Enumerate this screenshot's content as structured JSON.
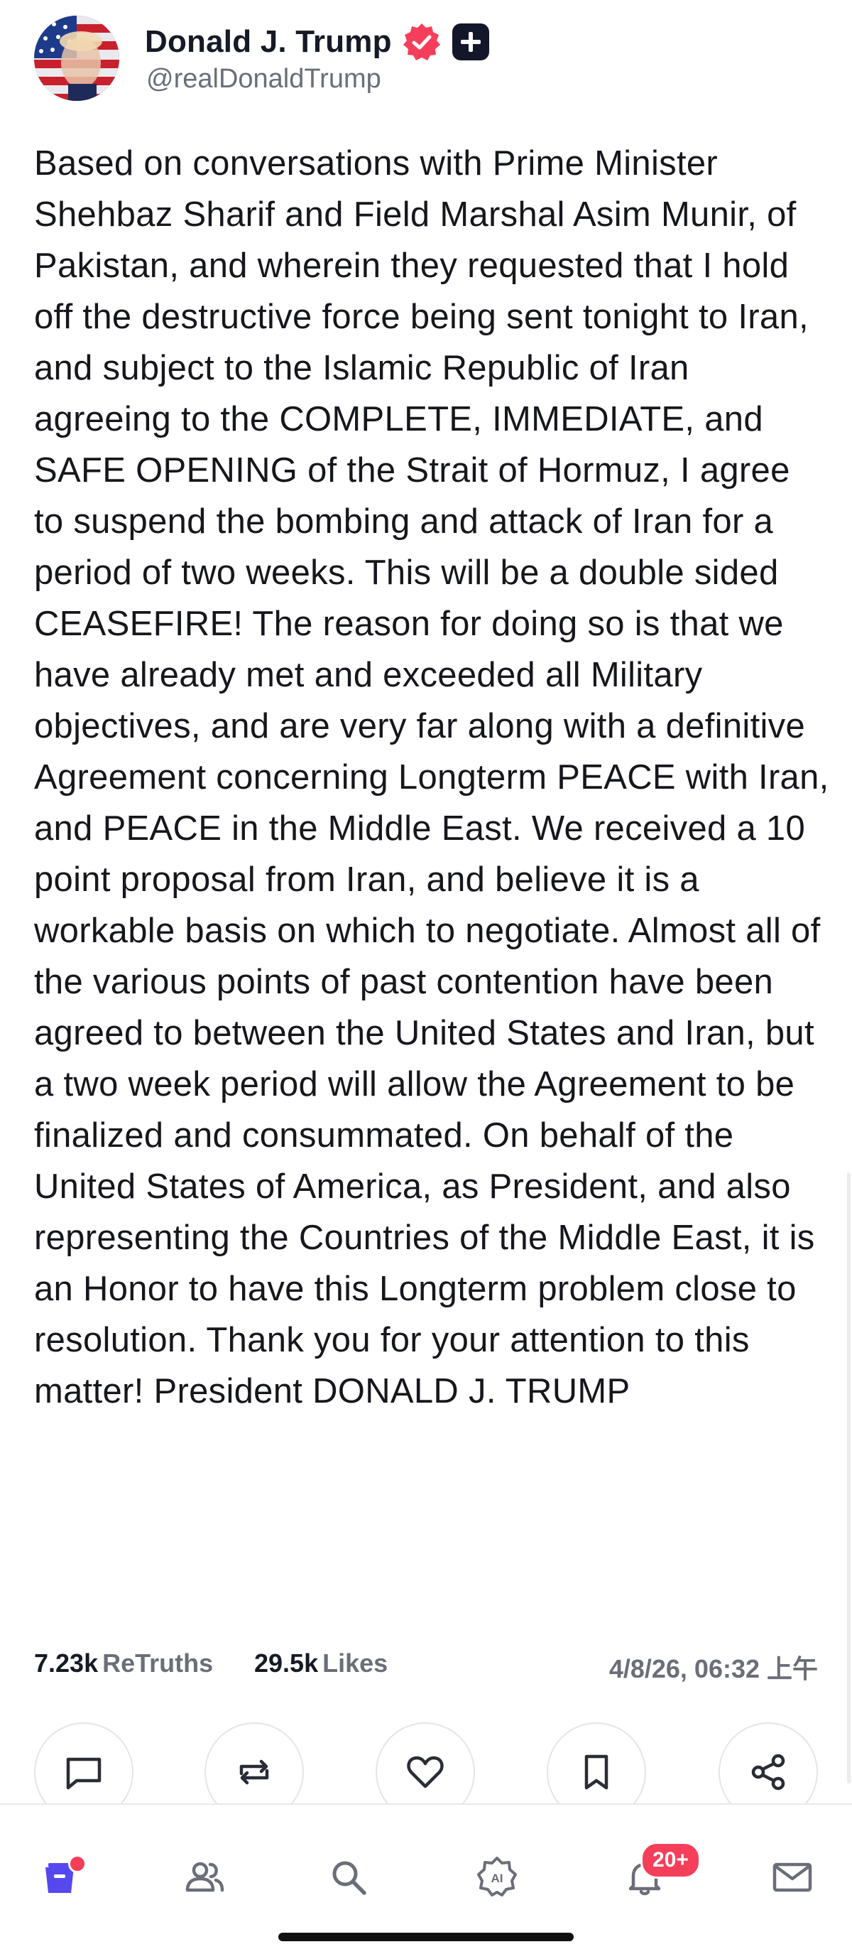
{
  "author": {
    "display_name": "Donald J. Trump",
    "handle": "@realDonaldTrump"
  },
  "post": {
    "text": "Based on conversations with Prime Minister Shehbaz Sharif and Field Marshal Asim Munir, of Pakistan, and wherein they requested that I hold off the destructive force being sent tonight to Iran, and subject to the Islamic Republic of Iran agreeing to the COMPLETE, IMMEDIATE, and SAFE OPENING of the Strait of Hormuz, I agree to suspend the bombing and attack of Iran for a period of two weeks. This will be a double sided CEASEFIRE! The reason for doing so is that we have already met and exceeded all Military objectives, and are very far along with a definitive Agreement concerning Longterm PEACE with Iran, and PEACE in the Middle East. We received a 10 point proposal from Iran, and believe it is a workable basis on which to negotiate. Almost all of the various points of past contention have been agreed to between the United States and Iran, but a two week period will allow the Agreement to be finalized and consummated. On behalf of the United States of America, as President, and also representing the Countries of the Middle East, it is an Honor to have this Longterm problem close to resolution. Thank you for your attention to this matter! President DONALD J. TRUMP"
  },
  "stats": {
    "retruths_count": "7.23k",
    "retruths_label": "ReTruths",
    "likes_count": "29.5k",
    "likes_label": "Likes",
    "timestamp": "4/8/26, 06:32 上午"
  },
  "actions": [
    "reply-icon",
    "retruth-icon",
    "like-icon",
    "bookmark-icon",
    "share-icon"
  ],
  "tabbar": {
    "items": [
      "home-icon",
      "people-icon",
      "search-icon",
      "ai-icon",
      "bell-icon",
      "mail-icon"
    ],
    "notifications_badge": "20+"
  },
  "colors": {
    "accent": "#5448ee",
    "badge": "#f53f5a",
    "text_primary": "#161a26",
    "text_secondary": "#6b6e79"
  }
}
